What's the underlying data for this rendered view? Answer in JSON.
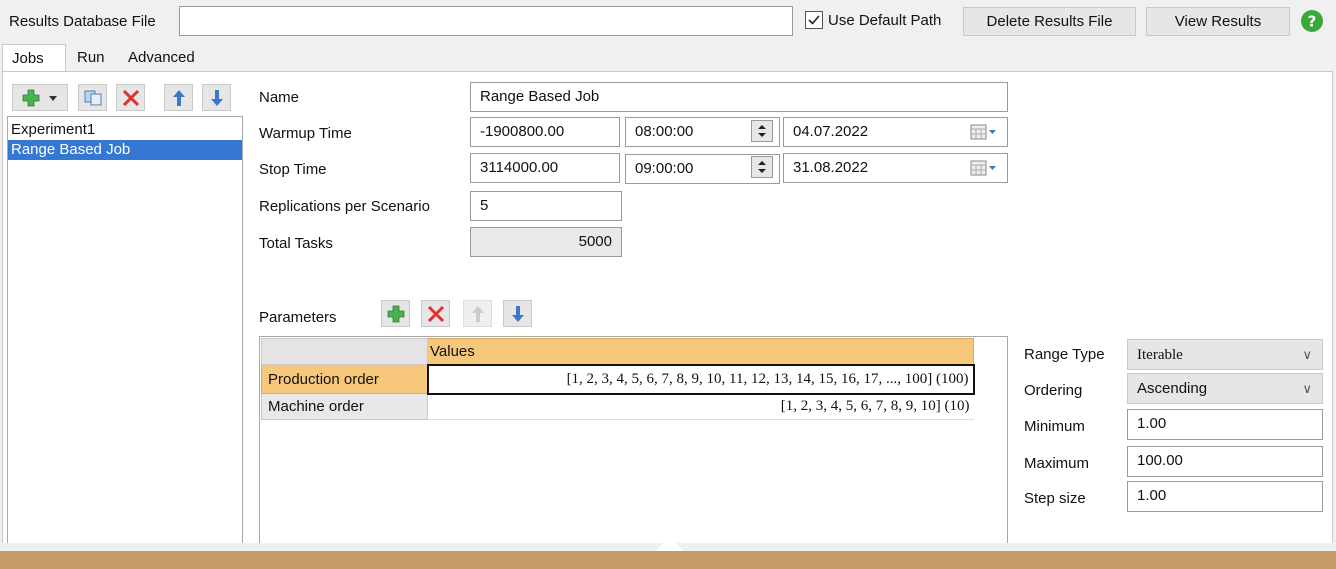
{
  "header": {
    "results_db_label": "Results Database File",
    "results_db_value": "",
    "use_default_path_label": "Use Default Path",
    "use_default_path_checked": true,
    "delete_results_label": "Delete Results File",
    "view_results_label": "View Results",
    "help_icon": "help-icon"
  },
  "tabs": [
    {
      "label": "Jobs",
      "active": true
    },
    {
      "label": "Run",
      "active": false
    },
    {
      "label": "Advanced",
      "active": false
    }
  ],
  "jobs": {
    "toolbar_icons": [
      "add-icon",
      "dropdown-arrow-icon",
      "copy-icon",
      "delete-icon",
      "move-up-icon",
      "move-down-icon"
    ],
    "items": [
      {
        "label": "Experiment1",
        "selected": false
      },
      {
        "label": "Range Based Job",
        "selected": true
      }
    ]
  },
  "form": {
    "name_label": "Name",
    "name_value": "Range Based Job",
    "warmup_label": "Warmup Time",
    "warmup_value": "-1900800.00",
    "warmup_time": "08:00:00",
    "warmup_date": "04.07.2022",
    "stop_label": "Stop Time",
    "stop_value": "3114000.00",
    "stop_time": "09:00:00",
    "stop_date": "31.08.2022",
    "replications_label": "Replications per Scenario",
    "replications_value": "5",
    "total_tasks_label": "Total Tasks",
    "total_tasks_value": "5000"
  },
  "parameters": {
    "label": "Parameters",
    "toolbar_icons": [
      "add-icon",
      "delete-icon",
      "move-up-icon",
      "move-down-icon"
    ],
    "column_header": "Values",
    "rows": [
      {
        "name": "Production order",
        "value": "[1, 2, 3, 4, 5, 6, 7, 8, 9, 10, 11, 12, 13, 14, 15, 16, 17, ..., 100] (100)",
        "selected": true
      },
      {
        "name": "Machine order",
        "value": "[1, 2, 3, 4, 5, 6, 7, 8, 9, 10] (10)",
        "selected": false
      }
    ]
  },
  "range": {
    "range_type_label": "Range Type",
    "range_type_value": "Iterable",
    "ordering_label": "Ordering",
    "ordering_value": "Ascending",
    "minimum_label": "Minimum",
    "minimum_value": "1.00",
    "maximum_label": "Maximum",
    "maximum_value": "100.00",
    "step_label": "Step size",
    "step_value": "1.00"
  },
  "colors": {
    "accent_orange": "#f7c77b",
    "selection_blue": "#3478d4",
    "footer_bar": "#c49a66",
    "help_green": "#3aa83a"
  }
}
